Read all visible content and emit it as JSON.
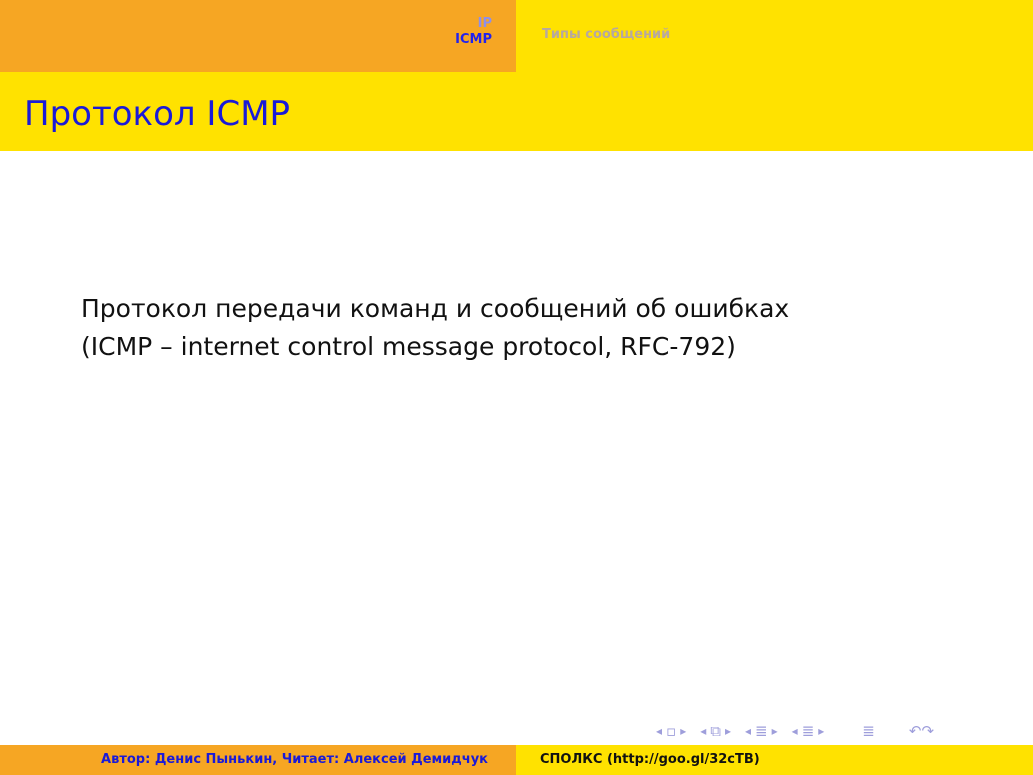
{
  "header": {
    "sections": [
      {
        "label": "IP",
        "active": false
      },
      {
        "label": "ICMP",
        "active": true
      }
    ],
    "subsection": "Типы сообщений"
  },
  "frame": {
    "title": "Протокол ICMP",
    "body_lines": [
      "Протокол передачи команд и сообщений об ошибках",
      "(ICMP – internet control message protocol, RFC-792)"
    ]
  },
  "navigation_icons": [
    "nav-prev-slide-icon",
    "nav-slide-icon",
    "nav-next-slide-icon",
    "nav-prev-frame-icon",
    "nav-frame-icon",
    "nav-next-frame-icon",
    "nav-prev-subsection-icon",
    "nav-subsection-icon",
    "nav-next-subsection-icon",
    "nav-prev-section-icon",
    "nav-section-icon",
    "nav-next-section-icon",
    "nav-toc-icon",
    "nav-search-icon"
  ],
  "footer": {
    "author": "Автор: Денис Пынькин, Читает: Алексей Демидчук",
    "course": "СПОЛКС (http://goo.gl/32cTB)"
  },
  "colors": {
    "accent_orange": "#f6a623",
    "accent_yellow": "#ffe200",
    "title_blue": "#1a1ad8",
    "nav_dim": "#9e9edb"
  }
}
